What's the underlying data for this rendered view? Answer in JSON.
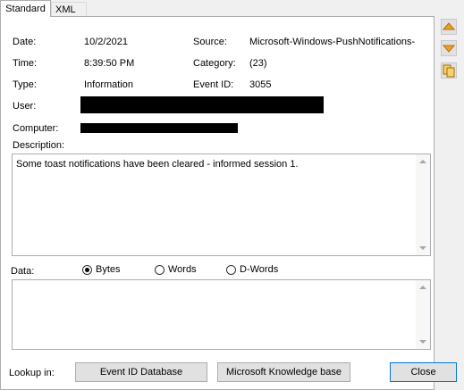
{
  "tabs": {
    "standard": "Standard",
    "xml": "XML"
  },
  "fields": {
    "date_label": "Date:",
    "date_value": "10/2/2021",
    "time_label": "Time:",
    "time_value": "8:39:50 PM",
    "type_label": "Type:",
    "type_value": "Information",
    "user_label": "User:",
    "computer_label": "Computer:",
    "source_label": "Source:",
    "source_value": "Microsoft-Windows-PushNotifications-",
    "category_label": "Category:",
    "category_value": "(23)",
    "event_id_label": "Event ID:",
    "event_id_value": "3055"
  },
  "description": {
    "label": "Description:",
    "text": "Some toast notifications have been cleared - informed session 1."
  },
  "data_section": {
    "label": "Data:",
    "options": [
      "Bytes",
      "Words",
      "D-Words"
    ],
    "selected": "Bytes"
  },
  "footer": {
    "lookup_label": "Lookup in:",
    "event_id_db_button": "Event ID Database",
    "kb_button": "Microsoft Knowledge base",
    "close_button": "Close"
  },
  "side_icons": [
    "up-arrow-icon",
    "down-arrow-icon",
    "copy-icon"
  ],
  "colors": {
    "accent": "#0078d7",
    "side_arrow": "#f0a020"
  }
}
